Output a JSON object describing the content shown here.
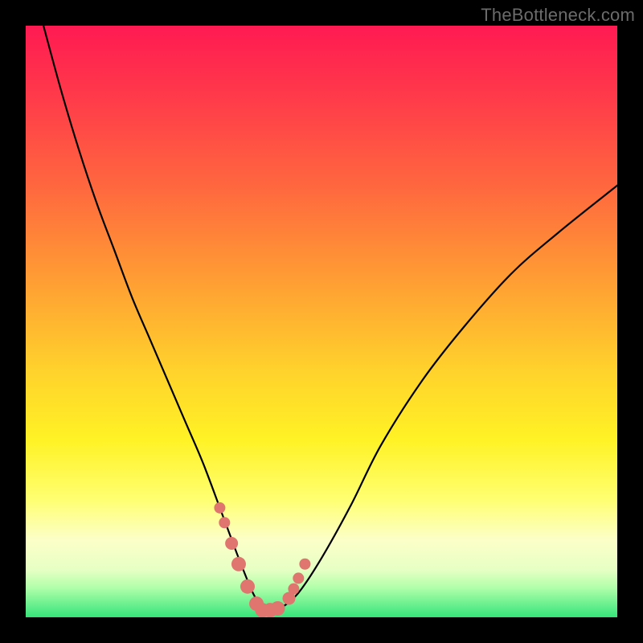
{
  "watermark": "TheBottleneck.com",
  "colors": {
    "background": "#000000",
    "curve": "#000000",
    "marker_fill": "#e0746f",
    "marker_stroke": "#b94e4a"
  },
  "chart_data": {
    "type": "line",
    "title": "",
    "xlabel": "",
    "ylabel": "",
    "xlim": [
      0,
      100
    ],
    "ylim": [
      0,
      100
    ],
    "grid": false,
    "legend": false,
    "annotations": [
      "TheBottleneck.com"
    ],
    "series": [
      {
        "name": "curve",
        "x": [
          3,
          6,
          9,
          12,
          15,
          18,
          21,
          24,
          27,
          30,
          33,
          34.5,
          36,
          38,
          39,
          40,
          41.5,
          43,
          46,
          50,
          55,
          60,
          67,
          74,
          82,
          90,
          100
        ],
        "y": [
          100,
          89,
          79,
          70,
          62,
          54,
          47,
          40,
          33,
          26,
          18,
          14,
          10,
          5,
          3,
          1.5,
          1,
          1.5,
          4,
          10,
          19,
          29,
          40,
          49,
          58,
          65,
          73
        ]
      }
    ],
    "markers": {
      "name": "highlighted-points",
      "x": [
        32.8,
        33.6,
        34.8,
        36.0,
        37.5,
        39.0,
        40.0,
        41.3,
        42.6,
        44.5,
        45.3,
        46.1,
        47.2
      ],
      "y": [
        18.5,
        16.0,
        12.5,
        9.0,
        5.2,
        2.3,
        1.2,
        1.2,
        1.5,
        3.2,
        4.8,
        6.6,
        9.0
      ],
      "r": [
        7,
        7,
        8,
        9,
        9,
        9,
        9,
        9,
        9,
        8,
        7,
        7,
        7
      ]
    }
  }
}
